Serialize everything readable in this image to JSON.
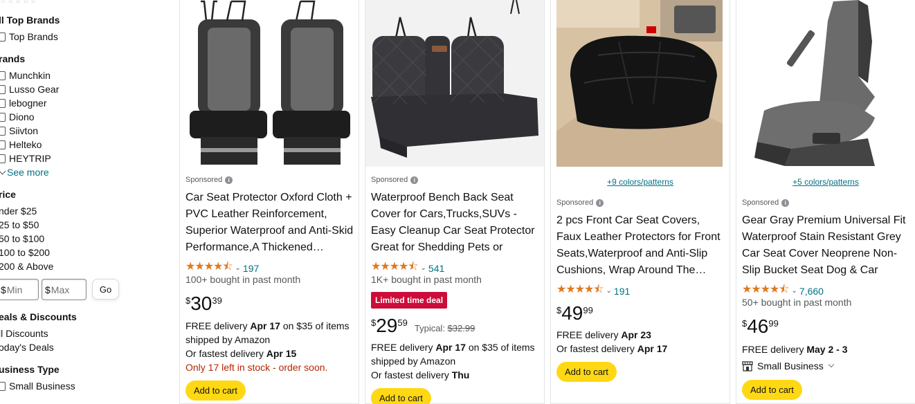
{
  "sidebar": {
    "top_brands_heading": "ll Top Brands",
    "top_brands_option": "Top Brands",
    "brands_heading": "rands",
    "brands": [
      "Munchkin",
      "Lusso Gear",
      "lebogner",
      "Diono",
      "Siivton",
      "Helteko",
      "HEYTRIP"
    ],
    "see_more": "See more",
    "price_heading": "rice",
    "price_ranges": [
      "nder $25",
      "25 to $50",
      "50 to $100",
      "100 to $200",
      "200 & Above"
    ],
    "min_currency": "$",
    "min_placeholder": "Min",
    "max_currency": "$",
    "max_placeholder": "Max",
    "go_label": "Go",
    "deals_heading": "eals & Discounts",
    "deals": [
      "ll Discounts",
      "oday's Deals"
    ],
    "business_heading": "usiness Type",
    "business_option": "Small Business"
  },
  "products": [
    {
      "sponsored": "Sponsored",
      "title": "Car Seat Protector Oxford Cloth + PVC Leather Reinforcement, Superior Waterproof and Anti-Skid Performance,A Thickened…",
      "stars": "★★★★⯪",
      "rating_count": "197",
      "bought": "100+ bought in past month",
      "price_symbol": "$",
      "price_whole": "30",
      "price_fraction": "39",
      "delivery_prefix": "FREE delivery ",
      "delivery_date": "Apr 17",
      "delivery_suffix": " on $35 of items",
      "shipped_by": "shipped by Amazon",
      "fastest_prefix": "Or fastest delivery ",
      "fastest_date": "Apr 15",
      "stock": "Only 17 left in stock - order soon.",
      "add_to_cart": "Add to cart"
    },
    {
      "sponsored": "Sponsored",
      "title": "Waterproof Bench Back Seat Cover for Cars,Trucks,SUVs - Easy Cleanup Car Seat Protector Great for Shedding Pets or Messy…",
      "stars": "★★★★⯪",
      "rating_count": "541",
      "bought": "1K+ bought in past month",
      "deal_badge": "Limited time deal",
      "price_symbol": "$",
      "price_whole": "29",
      "price_fraction": "59",
      "typical_label": "Typical: ",
      "typical_price": "$32.99",
      "delivery_prefix": "FREE delivery ",
      "delivery_date": "Apr 17",
      "delivery_suffix": " on $35 of items",
      "shipped_by": "shipped by Amazon",
      "fastest_prefix": "Or fastest delivery ",
      "fastest_date": "Thu",
      "add_to_cart": "Add to cart"
    },
    {
      "colors": "+9 colors/patterns",
      "sponsored": "Sponsored",
      "title": "2 pcs Front Car Seat Covers, Faux Leather Protectors for Front Seats,Waterproof and Anti-Slip Cushions, Wrap Around The…",
      "stars": "★★★★⯪",
      "rating_count": "191",
      "price_symbol": "$",
      "price_whole": "49",
      "price_fraction": "99",
      "delivery_prefix": "FREE delivery ",
      "delivery_date": "Apr 23",
      "fastest_prefix": "Or fastest delivery ",
      "fastest_date": "Apr 17",
      "add_to_cart": "Add to cart"
    },
    {
      "colors": "+5 colors/patterns",
      "sponsored": "Sponsored",
      "title": "Gear Gray Premium Universal Fit Waterproof Stain Resistant Grey Car Seat Cover Neoprene Non-Slip Bucket Seat Dog & Car Sea…",
      "stars": "★★★★⯪",
      "rating_count": "7,660",
      "bought": "50+ bought in past month",
      "price_symbol": "$",
      "price_whole": "46",
      "price_fraction": "99",
      "delivery_prefix": "FREE delivery ",
      "delivery_date": "May 2 - 3",
      "small_business": "Small Business",
      "add_to_cart": "Add to cart"
    }
  ],
  "colors": {
    "link": "#007185",
    "star": "#de7921",
    "add_to_cart_bg": "#ffd814",
    "deal_badge_bg": "#cc0c39",
    "stock_text": "#b12704"
  }
}
